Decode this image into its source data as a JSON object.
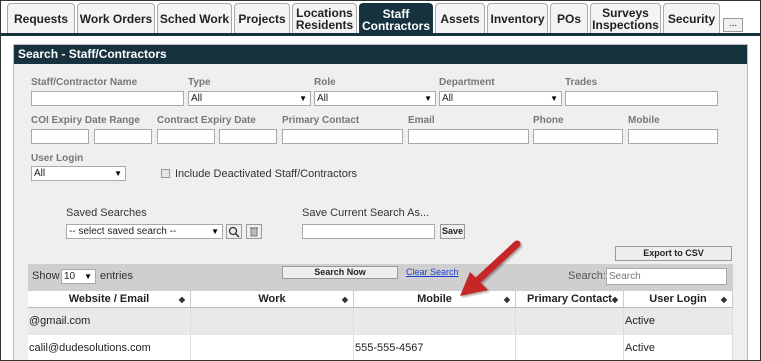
{
  "tabs": [
    {
      "label": "Requests"
    },
    {
      "label": "Work Orders"
    },
    {
      "label": "Sched Work"
    },
    {
      "label": "Projects"
    },
    {
      "label": "Locations\nResidents"
    },
    {
      "label": "Staff\nContractors"
    },
    {
      "label": "Assets"
    },
    {
      "label": "Inventory"
    },
    {
      "label": "POs"
    },
    {
      "label": "Surveys\nInspections"
    },
    {
      "label": "Security"
    }
  ],
  "tab_more_label": "...",
  "panel_title": "Search - Staff/Contractors",
  "labels": {
    "name": "Staff/Contractor Name",
    "type": "Type",
    "role": "Role",
    "department": "Department",
    "trades": "Trades",
    "coi": "COI Expiry Date Range",
    "contract": "Contract Expiry Date",
    "primary_contact": "Primary Contact",
    "email": "Email",
    "phone": "Phone",
    "mobile": "Mobile",
    "user_login": "User Login",
    "include_deactivated": "Include Deactivated Staff/Contractors",
    "saved_searches": "Saved Searches",
    "save_current": "Save Current Search As..."
  },
  "selects": {
    "type": "All",
    "role": "All",
    "department": "All",
    "user_login": "All",
    "saved": "-- select saved search --",
    "entries": "10"
  },
  "buttons": {
    "save": "Save",
    "export": "Export to CSV",
    "search_now": "Search Now",
    "clear_search": "Clear Search"
  },
  "toolbar": {
    "show": "Show",
    "entries": "entries",
    "search": "Search:",
    "search_placeholder": "Search"
  },
  "table": {
    "headers": [
      "Website / Email",
      "Work",
      "Mobile",
      "Primary Contact",
      "User Login"
    ],
    "rows": [
      [
        "@gmail.com",
        "",
        "",
        "",
        "Active"
      ],
      [
        "calil@dudesolutions.com",
        "",
        "555-555-4567",
        "",
        "Active"
      ]
    ]
  },
  "colors": {
    "tab_active": "#17323f",
    "annotation_arrow": "#c62828"
  }
}
